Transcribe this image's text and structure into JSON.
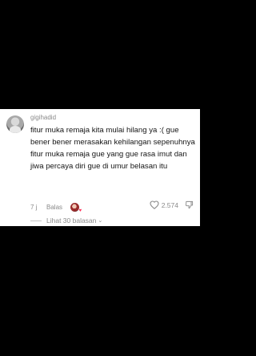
{
  "comment": {
    "username": "gigihadid",
    "text": "fitur muka remaja kita mulai hilang ya :( gue bener bener merasakan kehilangan sepenuhnya fitur muka remaja gue yang gue rasa imut dan jiwa percaya diri gue di umur belasan itu",
    "time": "7 j",
    "reply_label": "Balas",
    "like_count": "2.574",
    "view_replies_label": "Lihat 30 balasan",
    "icons": {
      "avatar": "user-avatar",
      "creator_avatar": "creator-avatar",
      "like": "heart-outline-icon",
      "dislike": "thumbs-down-icon",
      "expand": "chevron-down-icon"
    }
  },
  "colors": {
    "background": "#000000",
    "card": "#ffffff",
    "text": "#161616",
    "muted": "#8a8a8a",
    "accent": "#fe2c55"
  }
}
